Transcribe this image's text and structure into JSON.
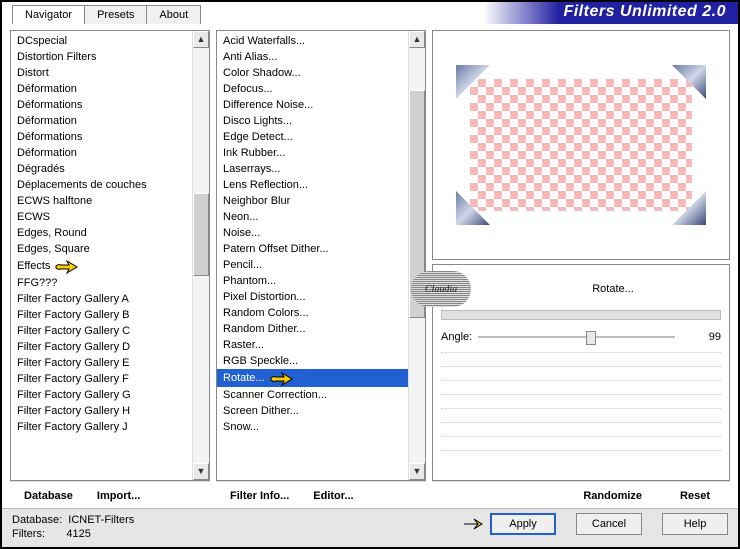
{
  "app_title": "Filters Unlimited 2.0",
  "tabs": {
    "navigator": "Navigator",
    "presets": "Presets",
    "about": "About"
  },
  "categories": {
    "items": [
      "DCspecial",
      "Distortion Filters",
      "Distort",
      "Déformation",
      "Déformations",
      "Déformation",
      "Déformations",
      "Déformation",
      "Dégradés",
      "Déplacements de couches",
      "ECWS halftone",
      "ECWS",
      "Edges, Round",
      "Edges, Square",
      "Effects",
      "FFG???",
      "Filter Factory Gallery A",
      "Filter Factory Gallery B",
      "Filter Factory Gallery C",
      "Filter Factory Gallery D",
      "Filter Factory Gallery E",
      "Filter Factory Gallery F",
      "Filter Factory Gallery G",
      "Filter Factory Gallery H",
      "Filter Factory Gallery J"
    ],
    "pointer_index": 14
  },
  "filters": {
    "items": [
      "Acid Waterfalls...",
      "Anti Alias...",
      "Color Shadow...",
      "Defocus...",
      "Difference Noise...",
      "Disco Lights...",
      "Edge Detect...",
      "Ink Rubber...",
      "Laserrays...",
      "Lens Reflection...",
      "Neighbor Blur",
      "Neon...",
      "Noise...",
      "Patern Offset Dither...",
      "Pencil...",
      "Phantom...",
      "Pixel Distortion...",
      "Random Colors...",
      "Random Dither...",
      "Raster...",
      "RGB Speckle...",
      "Rotate...",
      "Scanner Correction...",
      "Screen Dither...",
      "Snow..."
    ],
    "selected_index": 21,
    "pointer_index": 21
  },
  "buttons": {
    "database": "Database",
    "import": "Import...",
    "filter_info": "Filter Info...",
    "editor": "Editor...",
    "randomize": "Randomize",
    "reset": "Reset",
    "apply": "Apply",
    "cancel": "Cancel",
    "help": "Help"
  },
  "params": {
    "title": "Rotate...",
    "angle_label": "Angle:",
    "angle_value": "99"
  },
  "watermark": "Claudia",
  "status": {
    "db_label": "Database:",
    "db_value": "ICNET-Filters",
    "filters_label": "Filters:",
    "filters_value": "4125"
  }
}
